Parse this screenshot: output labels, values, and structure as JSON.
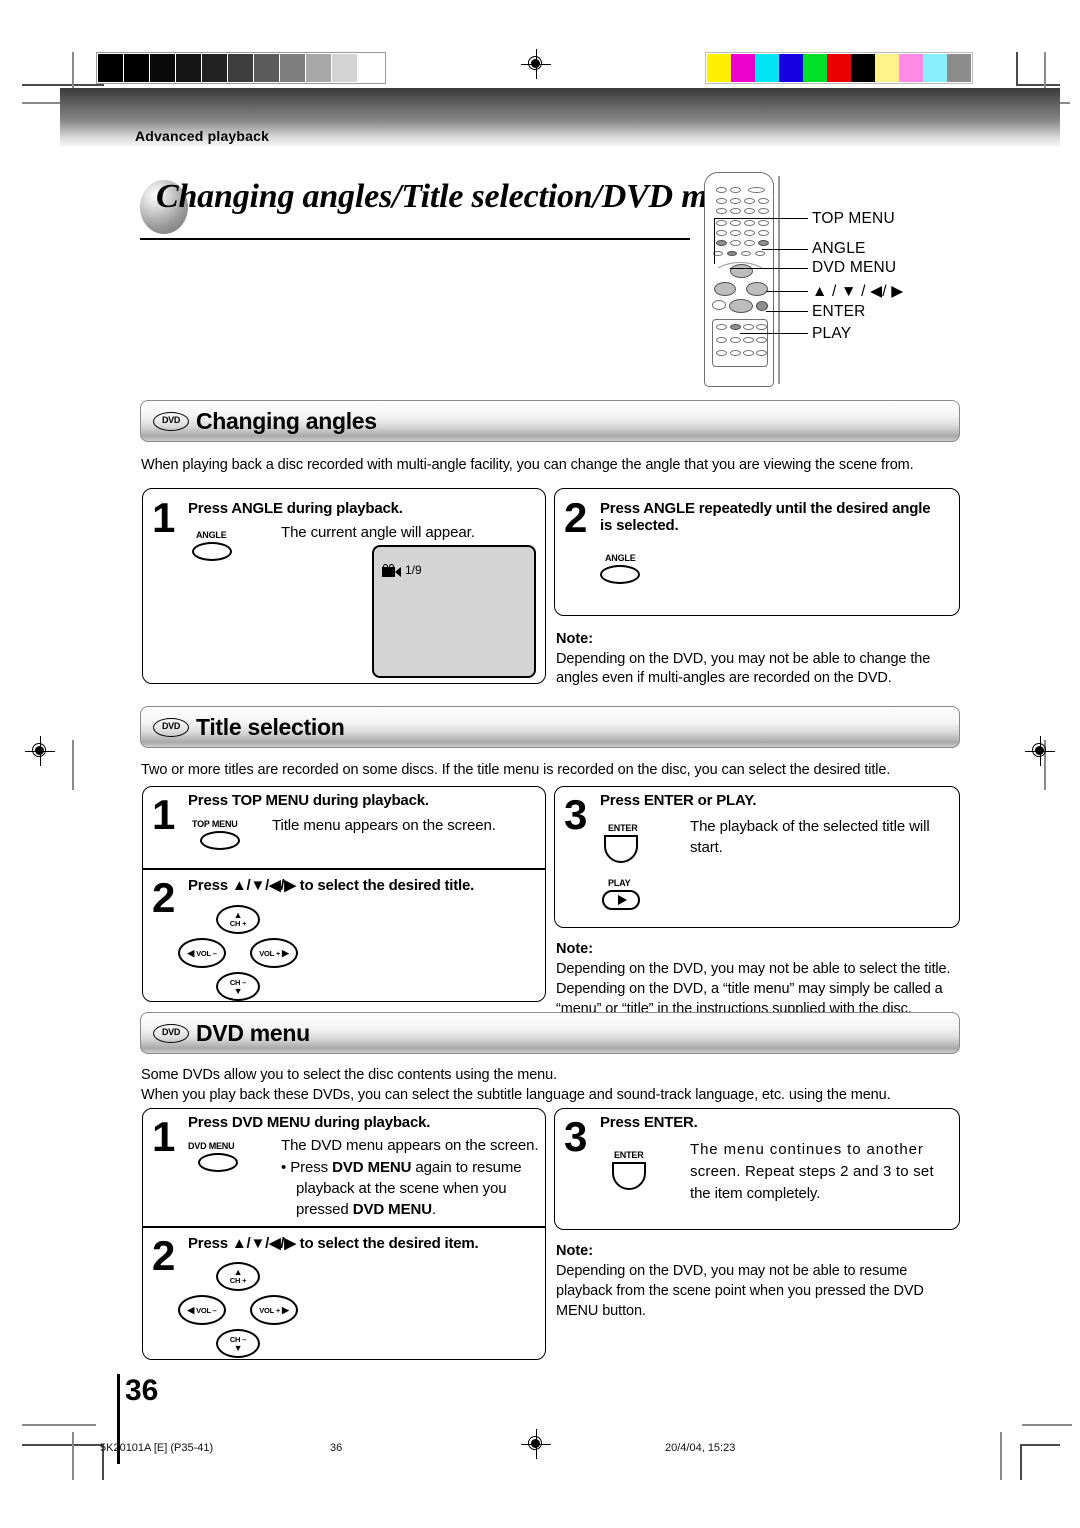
{
  "header": {
    "section_label": "Advanced playback",
    "title": "Changing angles/Title selection/DVD menu"
  },
  "remote_callouts": [
    {
      "label": "TOP MENU"
    },
    {
      "label": "ANGLE"
    },
    {
      "label": "DVD MENU"
    },
    {
      "label": "▲ / ▼ / ◀/ ▶"
    },
    {
      "label": "ENTER"
    },
    {
      "label": "PLAY"
    }
  ],
  "sections": [
    {
      "badge": "DVD",
      "title": "Changing angles",
      "intro": "When playing back a disc recorded with multi-angle facility, you can change the angle that you are viewing the scene from.",
      "step1": {
        "num": "1",
        "head": "Press ANGLE during playback.",
        "key_label": "ANGLE",
        "body": "The current angle will appear.",
        "screen_value": "1/9"
      },
      "step2": {
        "num": "2",
        "head_line1": "Press ANGLE repeatedly until the desired angle",
        "head_line2": "is selected.",
        "key_label": "ANGLE"
      },
      "note": {
        "head": "Note:",
        "line1": "Depending on the DVD, you may not be able to change the",
        "line2": "angles even if multi-angles are recorded on the DVD."
      }
    },
    {
      "badge": "DVD",
      "title": "Title selection",
      "intro": "Two or more titles are recorded on some discs. If the title menu is recorded on the disc, you can select the desired title.",
      "step1": {
        "num": "1",
        "head": "Press TOP MENU during playback.",
        "key_label": "TOP MENU",
        "body": "Title menu appears on the screen."
      },
      "step2": {
        "num": "2",
        "head_prefix": "Press ",
        "head_arrows": "▲/▼/◀/▶",
        "head_suffix": " to select the desired title."
      },
      "step3": {
        "num": "3",
        "head": "Press ENTER or PLAY.",
        "key_label_enter": "ENTER",
        "key_label_play": "PLAY",
        "body_line1": "The playback of the selected title will",
        "body_line2": "start."
      },
      "note": {
        "head": "Note:",
        "line1": "Depending on the DVD, you may not be able to select the title.",
        "line2": "Depending on the DVD, a “title menu” may simply be called a",
        "line3": "“menu” or “title” in the instructions supplied with the disc."
      }
    },
    {
      "badge": "DVD",
      "title": "DVD menu",
      "intro_line1": "Some DVDs allow you to select the disc contents using the menu.",
      "intro_line2": "When you play back these DVDs, you can select the subtitle language and sound-track language, etc. using the menu.",
      "step1": {
        "num": "1",
        "head": "Press DVD MENU during playback.",
        "key_label": "DVD MENU",
        "body": "The DVD menu appears on the screen.",
        "bullet_mark": "•",
        "bullet_part1": "Press ",
        "bullet_bold1": "DVD MENU",
        "bullet_part2": " again to resume",
        "bullet_line2": "playback at the scene when you",
        "bullet_part3": "pressed ",
        "bullet_bold2": "DVD MENU",
        "bullet_part4": "."
      },
      "step2": {
        "num": "2",
        "head_prefix": "Press ",
        "head_arrows": "▲/▼/◀/▶",
        "head_suffix": " to select the desired item."
      },
      "step3": {
        "num": "3",
        "head": "Press ENTER.",
        "key_label_enter": "ENTER",
        "body_line1": "The menu continues to another",
        "body_line2": "screen. Repeat steps 2 and 3 to set",
        "body_line3": "the item completely."
      },
      "note": {
        "head": "Note:",
        "line1": "Depending on the DVD, you may not be able to resume",
        "line2": "playback from the scene point when you pressed the DVD",
        "line3": "MENU button."
      }
    }
  ],
  "dpad": {
    "up_glyph": "▲",
    "up_text": "CH +",
    "down_text": "CH –",
    "down_glyph": "▼",
    "left_glyph": "◀",
    "left_text": "VOL –",
    "right_text": "VOL +",
    "right_glyph": "▶"
  },
  "footer": {
    "page_number": "36",
    "doc_code": "5K20101A [E] (P35-41)",
    "page_marker": "36",
    "timestamp": "20/4/04, 15:23"
  },
  "print_marks": {
    "gray_wedge": [
      "#000000",
      "#000000",
      "#0a0a0a",
      "#151515",
      "#222222",
      "#3d3d3d",
      "#5c5c5c",
      "#7f7f7f",
      "#a8a8a8",
      "#d4d4d4",
      "#ffffff"
    ],
    "color_bars": [
      "#ffee00",
      "#ee00cc",
      "#00e5f5",
      "#1400e0",
      "#00e028",
      "#ee0000",
      "#000000",
      "#fff28a",
      "#ff8ae8",
      "#8af0ff",
      "#8c8c8c"
    ]
  }
}
